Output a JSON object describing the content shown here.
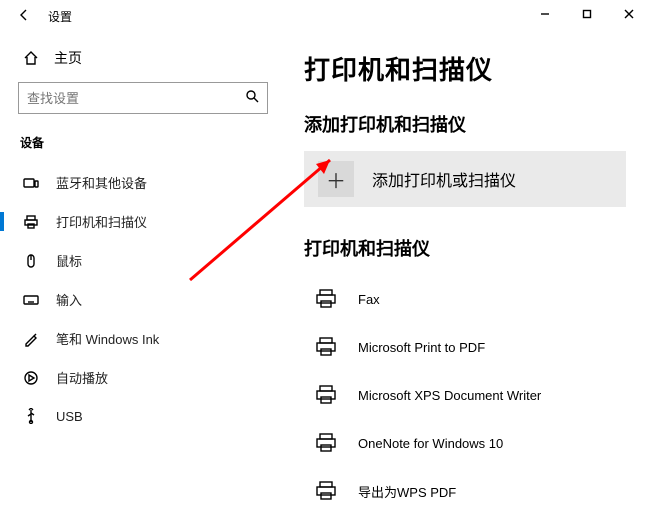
{
  "titlebar": {
    "title": "设置"
  },
  "sidebar": {
    "home_label": "主页",
    "search_placeholder": "查找设置",
    "group_header": "设备",
    "items": [
      {
        "label": "蓝牙和其他设备"
      },
      {
        "label": "打印机和扫描仪"
      },
      {
        "label": "鼠标"
      },
      {
        "label": "输入"
      },
      {
        "label": "笔和 Windows Ink"
      },
      {
        "label": "自动播放"
      },
      {
        "label": "USB"
      }
    ]
  },
  "main": {
    "page_heading": "打印机和扫描仪",
    "add_section_heading": "添加打印机和扫描仪",
    "add_button_label": "添加打印机或扫描仪",
    "list_heading": "打印机和扫描仪",
    "printers": [
      {
        "label": "Fax"
      },
      {
        "label": "Microsoft Print to PDF"
      },
      {
        "label": "Microsoft XPS Document Writer"
      },
      {
        "label": "OneNote for Windows 10"
      },
      {
        "label": "导出为WPS PDF"
      }
    ]
  }
}
